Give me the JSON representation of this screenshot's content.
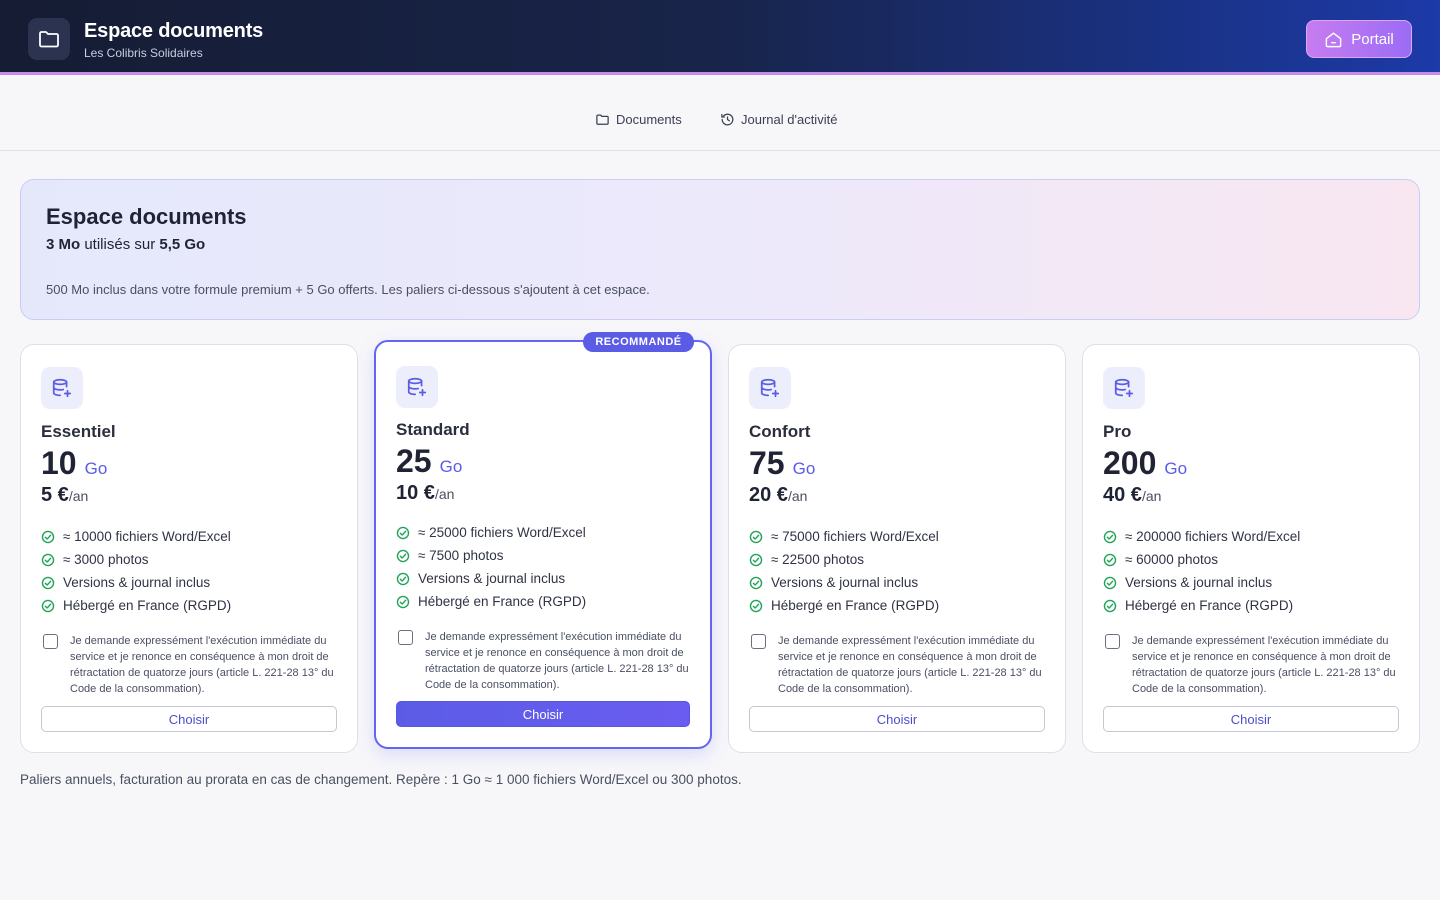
{
  "header": {
    "title": "Espace documents",
    "subtitle": "Les Colibris Solidaires",
    "portal_label": "Portail"
  },
  "nav": {
    "documents_label": "Documents",
    "activity_label": "Journal d'activité"
  },
  "banner": {
    "title": "Espace documents",
    "used": "3 Mo",
    "used_connector": "utilisés sur",
    "total": "5,5 Go",
    "note": "500 Mo inclus dans votre formule premium + 5 Go offerts. Les paliers ci-dessous s'ajoutent à cet espace."
  },
  "plans": [
    {
      "name": "Essentiel",
      "size": "10",
      "unit": "Go",
      "price": "5 €",
      "period": "/an",
      "features": [
        "≈ 10000 fichiers Word/Excel",
        "≈ 3000 photos",
        "Versions & journal inclus",
        "Hébergé en France (RGPD)"
      ],
      "consent": "Je demande expressément l'exécution immédiate du service et je renonce en conséquence à mon droit de rétractation de quatorze jours (article L. 221-28 13° du Code de la consommation).",
      "button": "Choisir"
    },
    {
      "name": "Standard",
      "size": "25",
      "unit": "Go",
      "price": "10 €",
      "period": "/an",
      "badge": "RECOMMANDÉ",
      "features": [
        "≈ 25000 fichiers Word/Excel",
        "≈ 7500 photos",
        "Versions & journal inclus",
        "Hébergé en France (RGPD)"
      ],
      "consent": "Je demande expressément l'exécution immédiate du service et je renonce en conséquence à mon droit de rétractation de quatorze jours (article L. 221-28 13° du Code de la consommation).",
      "button": "Choisir"
    },
    {
      "name": "Confort",
      "size": "75",
      "unit": "Go",
      "price": "20 €",
      "period": "/an",
      "features": [
        "≈ 75000 fichiers Word/Excel",
        "≈ 22500 photos",
        "Versions & journal inclus",
        "Hébergé en France (RGPD)"
      ],
      "consent": "Je demande expressément l'exécution immédiate du service et je renonce en conséquence à mon droit de rétractation de quatorze jours (article L. 221-28 13° du Code de la consommation).",
      "button": "Choisir"
    },
    {
      "name": "Pro",
      "size": "200",
      "unit": "Go",
      "price": "40 €",
      "period": "/an",
      "features": [
        "≈ 200000 fichiers Word/Excel",
        "≈ 60000 photos",
        "Versions & journal inclus",
        "Hébergé en France (RGPD)"
      ],
      "consent": "Je demande expressément l'exécution immédiate du service et je renonce en conséquence à mon droit de rétractation de quatorze jours (article L. 221-28 13° du Code de la consommation).",
      "button": "Choisir"
    }
  ],
  "footer_note": "Paliers annuels, facturation au prorata en cas de changement. Repère : 1 Go ≈ 1 000 fichiers Word/Excel ou 300 photos.",
  "colors": {
    "accent": "#5b5ce6",
    "check": "#22a35a",
    "header_dark": "#151c33",
    "header_blue": "#1c3aa8"
  },
  "icons": {
    "logo": "folder-icon",
    "portal": "home-icon",
    "documents": "folder-icon",
    "activity": "history-icon",
    "plan": "database-plus-icon",
    "feature": "check-circle-icon"
  }
}
